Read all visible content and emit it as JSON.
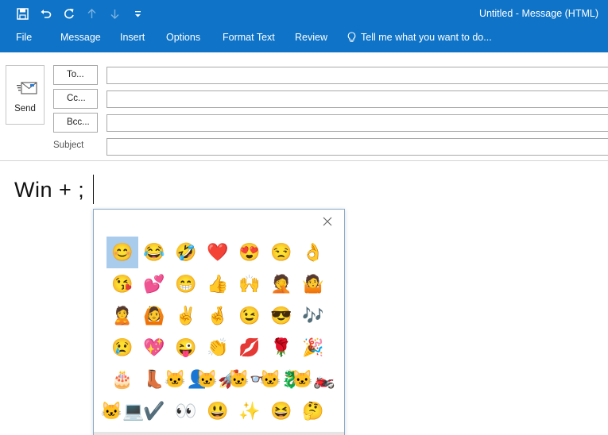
{
  "window": {
    "title": "Untitled - Message (HTML)"
  },
  "quick_access": [
    {
      "icon": "save-icon"
    },
    {
      "icon": "undo-icon"
    },
    {
      "icon": "redo-icon"
    },
    {
      "icon": "arrow-up-icon"
    },
    {
      "icon": "arrow-down-icon"
    },
    {
      "icon": "customize-icon"
    }
  ],
  "ribbon": {
    "tabs": [
      "File",
      "Message",
      "Insert",
      "Options",
      "Format Text",
      "Review"
    ],
    "tell_me": "Tell me what you want to do..."
  },
  "header": {
    "send_label": "Send",
    "to_label": "To...",
    "cc_label": "Cc...",
    "bcc_label": "Bcc...",
    "subject_label": "Subject"
  },
  "body": {
    "text": "Win + ;"
  },
  "emoji_panel": {
    "close_icon": "close-icon",
    "selected_index": 0,
    "emojis": [
      "😊",
      "😂",
      "🤣",
      "❤️",
      "😍",
      "😒",
      "👌",
      "😘",
      "💕",
      "😁",
      "👍",
      "🙌",
      "🤦",
      "🤷",
      "🙎",
      "🙆",
      "✌️",
      "🤞",
      "😉",
      "😎",
      "🎶",
      "😢",
      "💖",
      "😜",
      "👏",
      "💋",
      "🌹",
      "🎉",
      "🎂",
      "👢",
      "🐱‍👤",
      "🐱‍🚀",
      "🐱‍👓",
      "🐱‍🐉",
      "🐱‍🏍",
      "🐱‍💻",
      "✔️",
      "👀",
      "😃",
      "✨",
      "😆",
      "🤔"
    ]
  },
  "colors": {
    "brand": "#0f74c8",
    "selection": "#a9cbec"
  }
}
